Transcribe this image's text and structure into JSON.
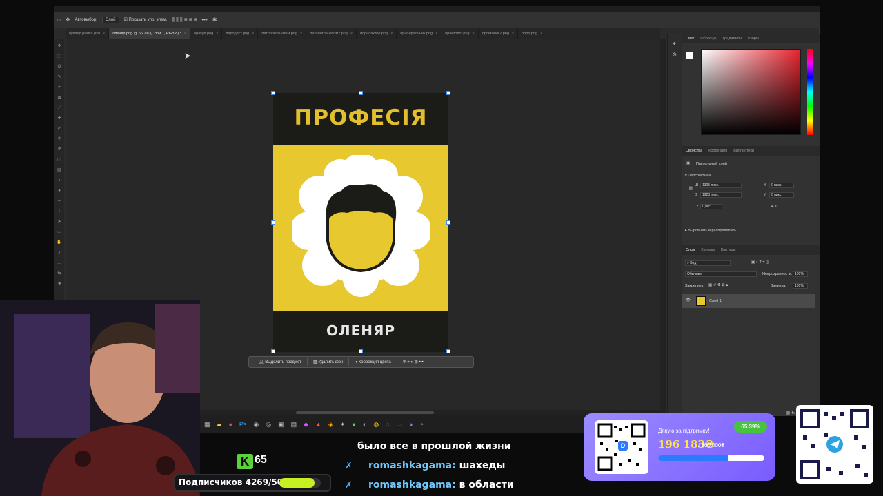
{
  "photoshop": {
    "options": {
      "autoselect": "Автовыбор:",
      "layer_select": "Слой",
      "show_transform": "Показать упр. элем."
    },
    "tabs": [
      {
        "label": "буклер рамка.psd"
      },
      {
        "label": "оленяр.png @ 66,7% (Слой 1, RGB/8) *"
      },
      {
        "label": "оракул.png"
      },
      {
        "label": "пародист.png"
      },
      {
        "label": "патологоанатом.png"
      },
      {
        "label": "патологоанатом2.png"
      },
      {
        "label": "порноактор.png"
      },
      {
        "label": "прибиральник.png"
      },
      {
        "label": "проктолог.png"
      },
      {
        "label": "проктолог2.png"
      },
      {
        "label": "рррр.png"
      }
    ],
    "poster": {
      "title": "ПРОФЕСІЯ",
      "name": "ОЛЕНЯР",
      "yellow": "#e8c82f",
      "dark": "#1b1b18"
    },
    "context_bar": {
      "select_subject": "Выделить предмет",
      "remove_bg": "Удалить фон",
      "color_correction": "Коррекция цвета"
    },
    "panels": {
      "color_tabs": [
        "Цвет",
        "Образцы",
        "Градиенты",
        "Узоры"
      ],
      "props_tabs": [
        "Свойства",
        "Коррекция",
        "Библиотеки"
      ],
      "pixel_layer": "Пиксельный слой",
      "perspective": "Перспектива",
      "w_label": "Ш",
      "w_value": "1305 пикс.",
      "h_label": "В",
      "h_value": "1923 пикс.",
      "x_label": "X",
      "x_value": "0 пикс.",
      "y_label": "Y",
      "y_value": "0 пикс.",
      "angle": "0,00°",
      "align": "Выровнять и распределить",
      "layers_tabs": [
        "Слои",
        "Каналы",
        "Контуры"
      ],
      "kind": "Вид",
      "blend": "Обычные",
      "opacity_label": "Непрозрачность:",
      "opacity_value": "100%",
      "lock_label": "Закрепить:",
      "fill_label": "Заливка:",
      "fill_value": "100%",
      "layer_name": "Слой 1"
    }
  },
  "overlay": {
    "chat": [
      {
        "user": "",
        "text": "было все в прошлой жизни"
      },
      {
        "user": "romashkagama:",
        "text": "шахеды"
      },
      {
        "user": "romashkagama:",
        "text": "в области"
      }
    ],
    "k_count": "65",
    "subs_label": "Подписчиков 4269/5000",
    "subs_progress": 0.854,
    "donation": {
      "thanks": "Дякую за підтримку!",
      "percent": "65.39%",
      "amount": "196 183₴",
      "goal": "/ 300 000₴",
      "progress": 0.6539
    }
  }
}
